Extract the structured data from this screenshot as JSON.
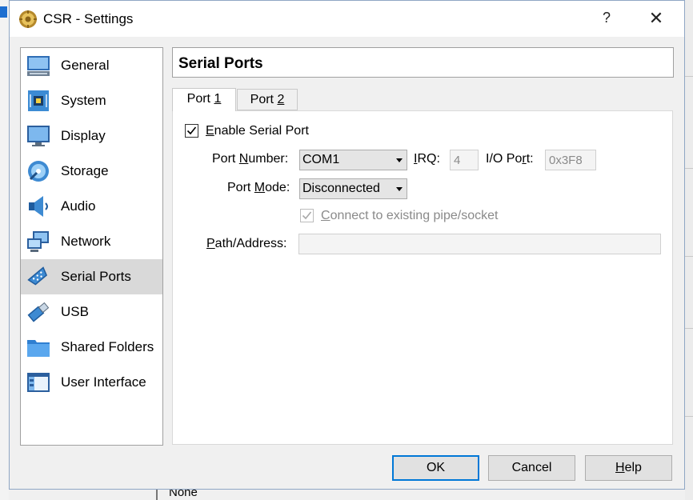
{
  "window": {
    "title": "CSR - Settings",
    "help_glyph": "?",
    "close_glyph": "✕"
  },
  "sidebar": {
    "selected": "Serial Ports",
    "items": [
      {
        "label": "General",
        "icon": "general-icon"
      },
      {
        "label": "System",
        "icon": "system-icon"
      },
      {
        "label": "Display",
        "icon": "display-icon"
      },
      {
        "label": "Storage",
        "icon": "storage-icon"
      },
      {
        "label": "Audio",
        "icon": "audio-icon"
      },
      {
        "label": "Network",
        "icon": "network-icon"
      },
      {
        "label": "Serial Ports",
        "icon": "serial-ports-icon"
      },
      {
        "label": "USB",
        "icon": "usb-icon"
      },
      {
        "label": "Shared Folders",
        "icon": "shared-folders-icon"
      },
      {
        "label": "User Interface",
        "icon": "user-interface-icon"
      }
    ]
  },
  "page": {
    "title": "Serial Ports"
  },
  "tabs": [
    {
      "pre": "Port ",
      "mnemonic": "1",
      "active": true
    },
    {
      "pre": "Port ",
      "mnemonic": "2",
      "active": false
    }
  ],
  "form": {
    "enable": {
      "pre": "",
      "mnemonic": "E",
      "post": "nable Serial Port",
      "checked": true
    },
    "port_number": {
      "pre": "Port ",
      "mnemonic": "N",
      "post": "umber:",
      "value": "COM1"
    },
    "irq": {
      "pre": "",
      "mnemonic": "I",
      "post": "RQ:",
      "value": "4"
    },
    "io_port": {
      "pre": "I/O Po",
      "mnemonic": "r",
      "post": "t:",
      "value": "0x3F8"
    },
    "port_mode": {
      "pre": "Port ",
      "mnemonic": "M",
      "post": "ode:",
      "value": "Disconnected"
    },
    "connect_existing": {
      "pre": "",
      "mnemonic": "C",
      "post": "onnect to existing pipe/socket",
      "checked": true,
      "disabled": true
    },
    "path_address": {
      "pre": "",
      "mnemonic": "P",
      "post": "ath/Address:",
      "value": ""
    }
  },
  "buttons": {
    "ok": "OK",
    "cancel": "Cancel",
    "help": {
      "pre": "",
      "mnemonic": "H",
      "post": "elp"
    }
  },
  "background": {
    "bottom_text": "None"
  },
  "colors": {
    "accent": "#0078d7",
    "selected_item": "#d9d9d9"
  }
}
